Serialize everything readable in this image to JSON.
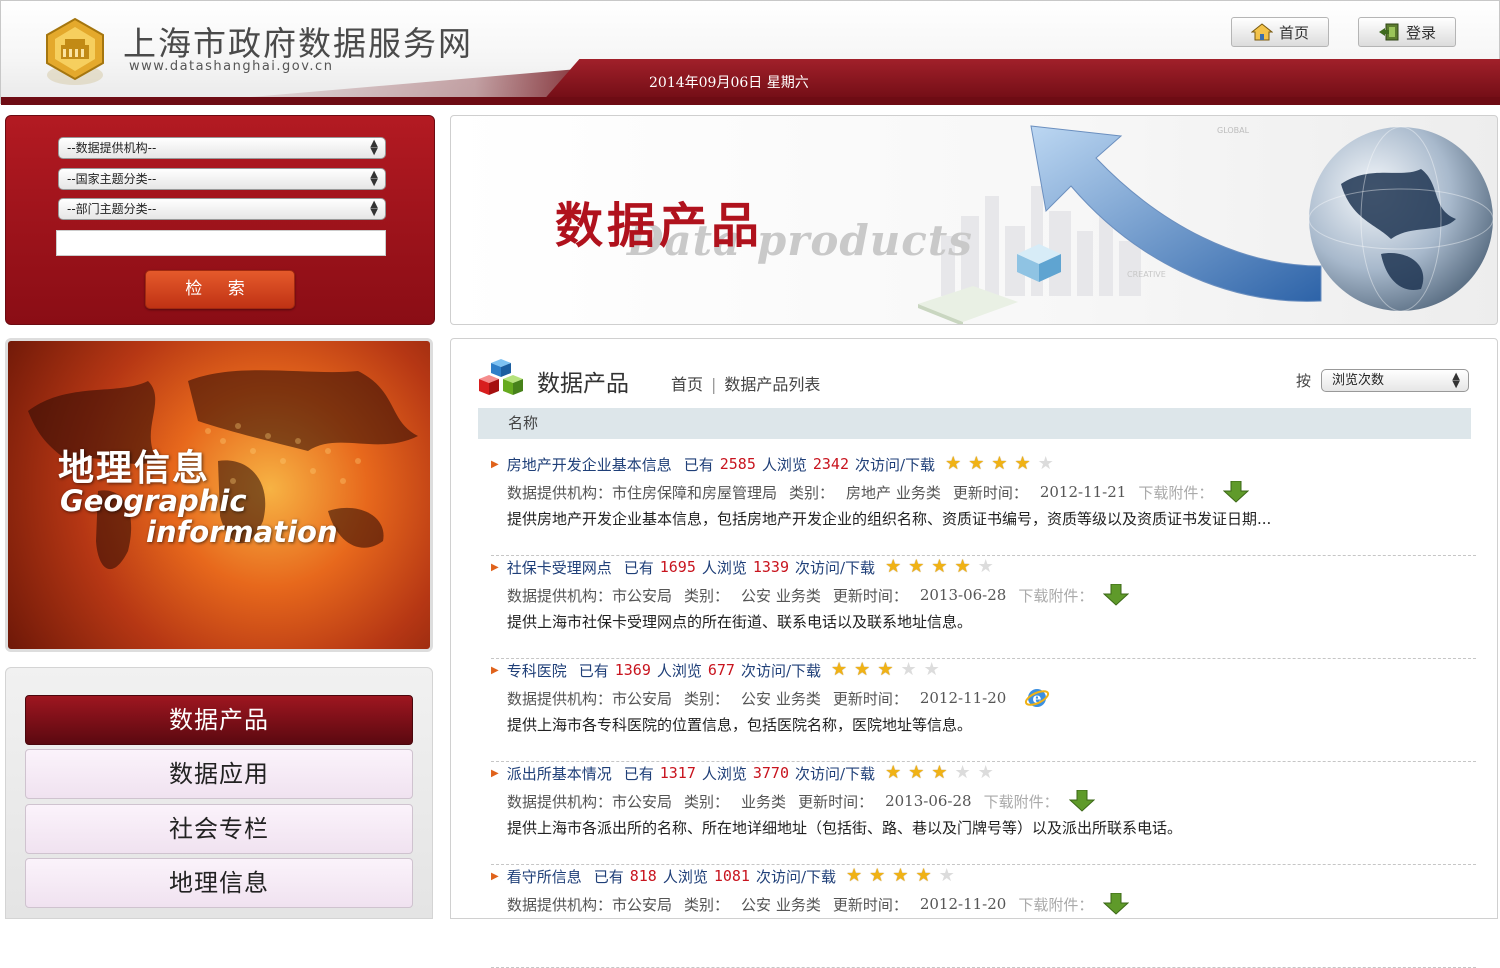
{
  "header": {
    "site_title": "上海市政府数据服务网",
    "site_url": "www.datashanghai.gov.cn",
    "date": "2014年09月06日  星期六",
    "home_label": "首页",
    "login_label": "登录"
  },
  "search": {
    "provider_select": "--数据提供机构--",
    "national_topic_select": "--国家主题分类--",
    "dept_topic_select": "--部门主题分类--",
    "keyword_value": "",
    "button_label": "检 索"
  },
  "banner": {
    "title": "数据产品",
    "subtitle": "Data products",
    "small_text_1": "GLOBAL",
    "small_text_2": "CREATIVE"
  },
  "geo_promo": {
    "title_cn": "地理信息",
    "title_en_1": "Geographic",
    "title_en_2": "information"
  },
  "nav": {
    "items": [
      {
        "label": "数据产品"
      },
      {
        "label": "数据应用"
      },
      {
        "label": "社会专栏"
      },
      {
        "label": "地理信息"
      }
    ]
  },
  "main": {
    "title": "数据产品",
    "breadcrumb": [
      "首页",
      "数据产品列表"
    ],
    "sort_label": "按",
    "sort_select": "浏览次数",
    "column_header": "名称",
    "labels": {
      "already": "已有",
      "views_label": "人浏览",
      "downloads_label": "次访问/下载",
      "provider_label": "数据提供机构：",
      "category_label": "类别：",
      "update_label": "更新时间：",
      "attachment_label": "下载附件："
    },
    "entries": [
      {
        "name": "房地产开发企业基本信息",
        "views": "2585",
        "downloads": "2342",
        "rating": 4,
        "provider": "市住房保障和房屋管理局",
        "category": "房地产  业务类",
        "updated": "2012-11-21",
        "description": "提供房地产开发企业基本信息，包括房地产开发企业的组织名称、资质证书编号，资质等级以及资质证书发证日期..."
      },
      {
        "name": "社保卡受理网点",
        "views": "1695",
        "downloads": "1339",
        "rating": 4,
        "provider": "市公安局",
        "category": "公安  业务类",
        "updated": "2013-06-28",
        "description": "提供上海市社保卡受理网点的所在街道、联系电话以及联系地址信息。"
      },
      {
        "name": "专科医院",
        "views": "1369",
        "downloads": "677",
        "rating": 3,
        "provider": "市公安局",
        "category": "公安  业务类",
        "updated": "2012-11-20",
        "description": "提供上海市各专科医院的位置信息，包括医院名称，医院地址等信息。"
      },
      {
        "name": "派出所基本情况",
        "views": "1317",
        "downloads": "3770",
        "rating": 3,
        "provider": "市公安局",
        "category": "业务类",
        "updated": "2013-06-28",
        "description": "提供上海市各派出所的名称、所在地详细地址（包括街、路、巷以及门牌号等）以及派出所联系电话。"
      },
      {
        "name": "看守所信息",
        "views": "818",
        "downloads": "1081",
        "rating": 4,
        "provider": "市公安局",
        "category": "公安  业务类",
        "updated": "2012-11-20",
        "description": ""
      }
    ]
  }
}
